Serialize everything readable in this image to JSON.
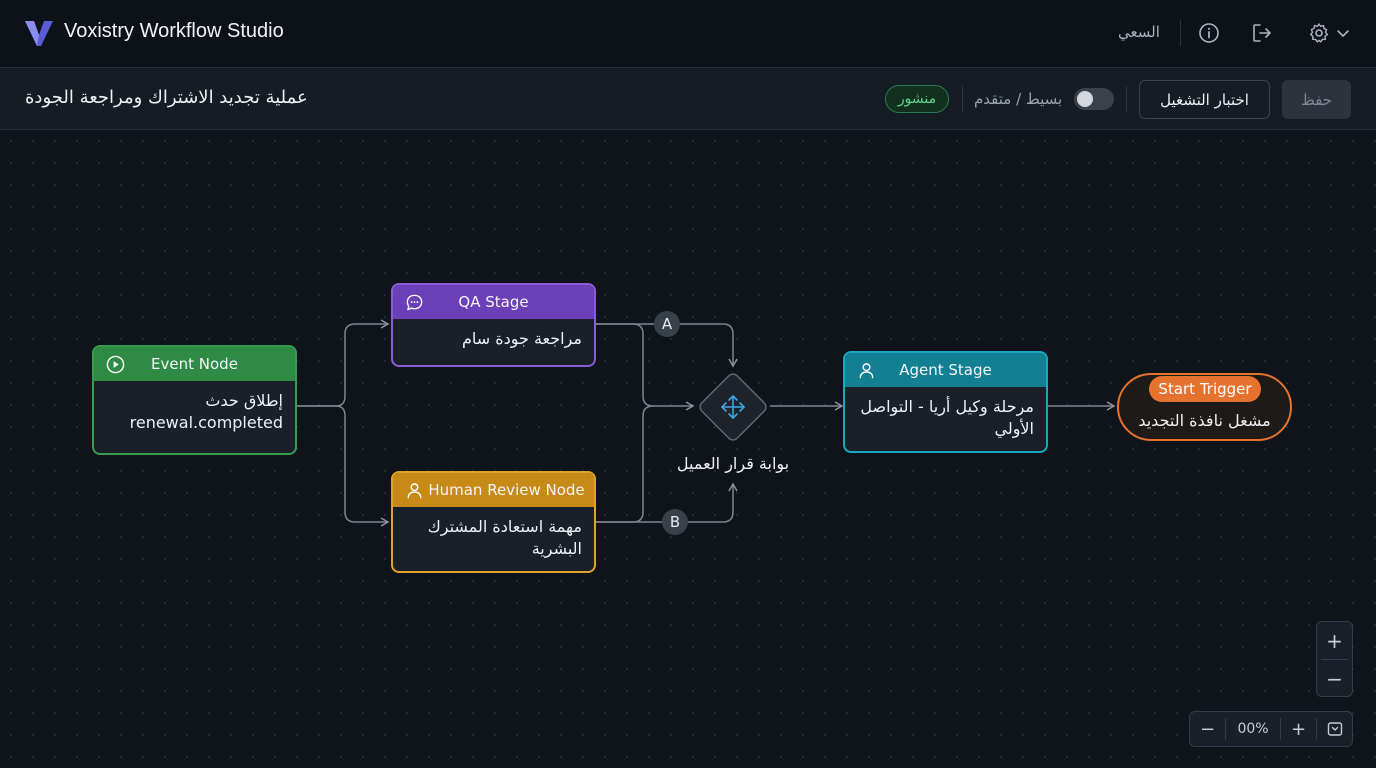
{
  "app": {
    "title": "Voxistry Workflow Studio",
    "user_name": "السعي"
  },
  "workflow": {
    "title": "عملية تجديد الاشتراك ومراجعة الجودة",
    "status_badge": "منشور",
    "mode_label": "بسيط / متقدم",
    "test_button": "اختبار التشغيل",
    "save_button": "حفظ"
  },
  "nodes": {
    "event": {
      "type": "Event Node",
      "label": "إطلاق حدث renewal.completed",
      "color": "#2f8a45"
    },
    "qa": {
      "type": "QA Stage",
      "label": "مراجعة جودة سام",
      "color": "#6b3fb8"
    },
    "human": {
      "type": "Human Review Node",
      "label": "مهمة استعادة المشترك البشرية",
      "color": "#c78a16"
    },
    "gate": {
      "label": "بوابة قرار العميل"
    },
    "agent": {
      "type": "Agent Stage",
      "label": "مرحلة وكيل أريا - التواصل الأولي",
      "color": "#137f93"
    },
    "trigger": {
      "type": "Start Trigger",
      "label": "مشغل نافذة التجديد",
      "color": "#e5722f"
    }
  },
  "branches": {
    "a": "A",
    "b": "B"
  },
  "zoom": {
    "in_vertical": "+",
    "out_vertical": "−",
    "out": "−",
    "level": "00%",
    "in": "+"
  },
  "icons": {
    "logo": "voxistry-logo",
    "info": "info-icon",
    "logout": "logout-icon",
    "settings": "gear-icon",
    "chevron": "chevron-down-icon",
    "play": "play-icon",
    "chat": "chat-icon",
    "person": "person-icon",
    "gate": "move-arrows-icon",
    "fit": "fit-view-icon"
  }
}
